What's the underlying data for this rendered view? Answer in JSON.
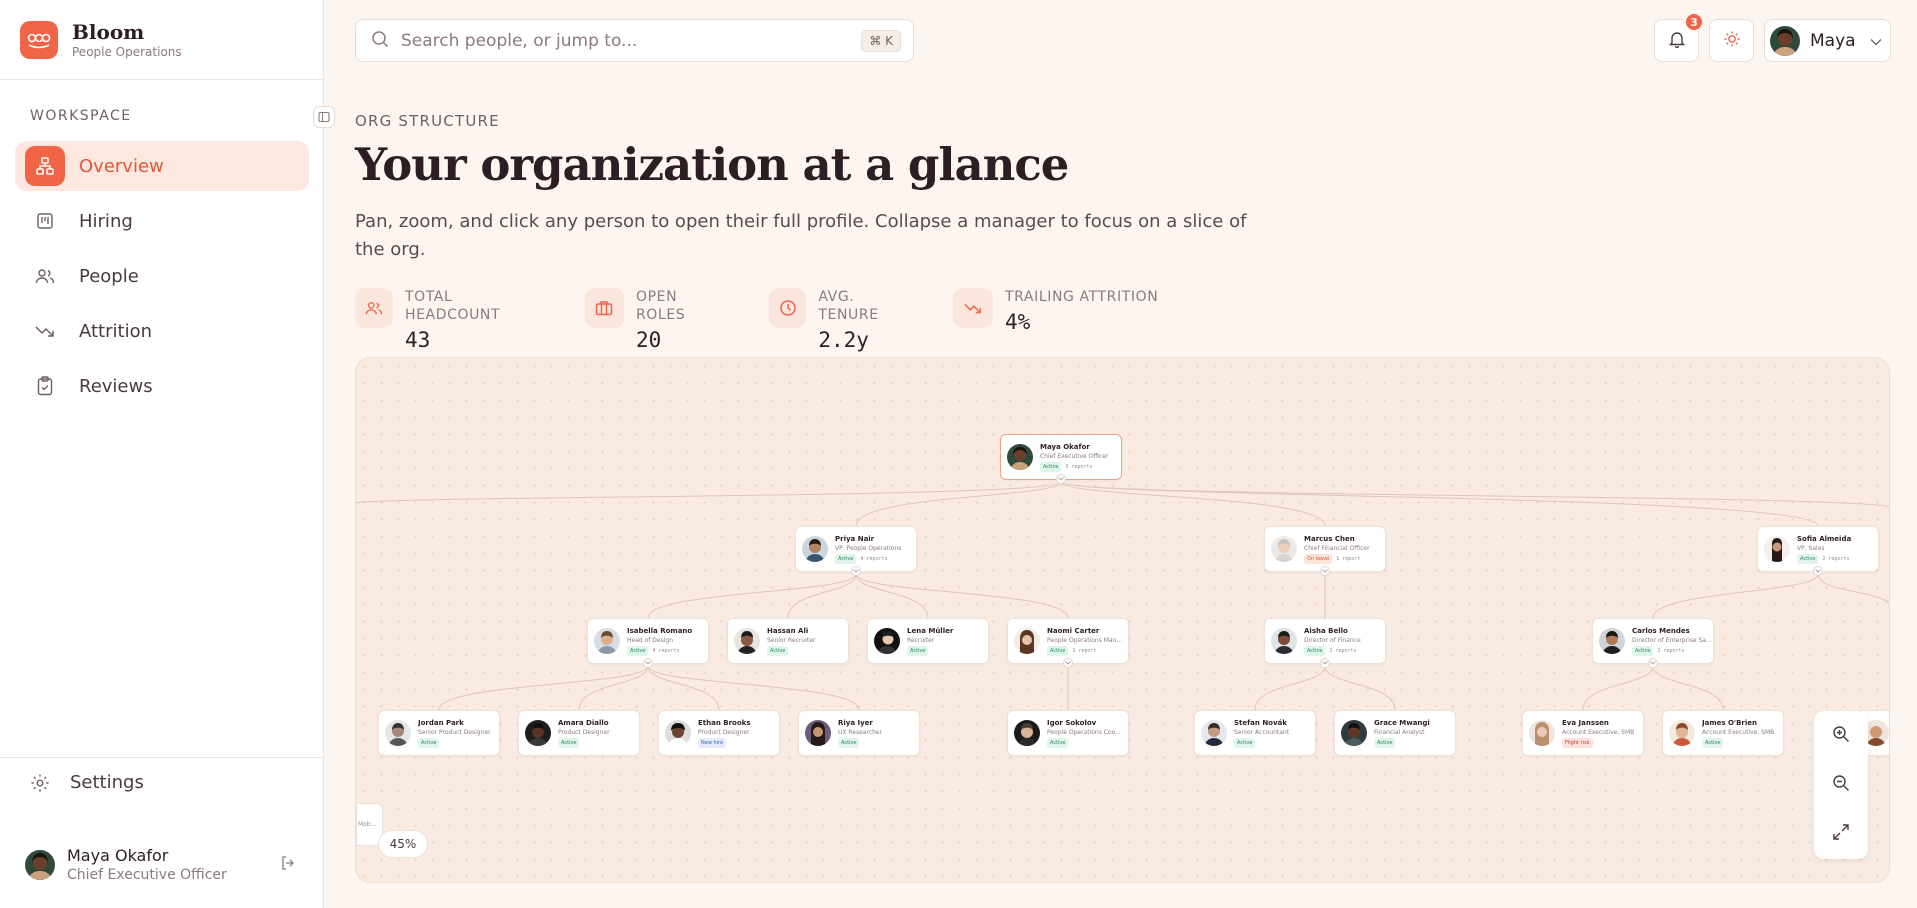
{
  "app": {
    "name": "Bloom",
    "subtitle": "People Operations"
  },
  "sidebar": {
    "section_label": "WORKSPACE",
    "items": [
      {
        "label": "Overview",
        "icon": "org-chart-icon",
        "active": true
      },
      {
        "label": "Hiring",
        "icon": "kanban-icon",
        "active": false
      },
      {
        "label": "People",
        "icon": "people-icon",
        "active": false
      },
      {
        "label": "Attrition",
        "icon": "trend-down-icon",
        "active": false
      },
      {
        "label": "Reviews",
        "icon": "clipboard-check-icon",
        "active": false
      }
    ],
    "settings_label": "Settings",
    "user": {
      "name": "Maya Okafor",
      "role": "Chief Executive Officer"
    }
  },
  "topbar": {
    "search_placeholder": "Search people, or jump to...",
    "shortcut": "⌘ K",
    "notification_count": "3",
    "user_name": "Maya"
  },
  "page": {
    "eyebrow": "ORG STRUCTURE",
    "title": "Your organization at a glance",
    "description": "Pan, zoom, and click any person to open their full profile. Collapse a manager to focus on a slice of the org."
  },
  "stats": [
    {
      "label": "TOTAL HEADCOUNT",
      "value": "43",
      "icon": "people-icon"
    },
    {
      "label": "OPEN ROLES",
      "value": "20",
      "icon": "briefcase-icon"
    },
    {
      "label": "AVG. TENURE",
      "value": "2.2y",
      "icon": "clock-icon"
    },
    {
      "label": "TRAILING ATTRITION",
      "value": "4%",
      "icon": "trend-down-icon"
    }
  ],
  "org": {
    "root": {
      "name": "Maya Okafor",
      "title": "Chief Executive Officer",
      "status": "Active",
      "reports": "5 reports"
    },
    "level1": [
      {
        "name": "Priya Nair",
        "title": "VP, People Operations",
        "status": "Active",
        "reports": "4 reports"
      },
      {
        "name": "Marcus Chen",
        "title": "Chief Financial Officer",
        "status": "On leave",
        "reports": "1 report"
      },
      {
        "name": "Sofia Almeida",
        "title": "VP, Sales",
        "status": "Active",
        "reports": "2 reports"
      }
    ],
    "level2": [
      {
        "name": "Isabella Romano",
        "title": "Head of Design",
        "status": "Active",
        "reports": "4 reports"
      },
      {
        "name": "Hassan Ali",
        "title": "Senior Recruiter",
        "status": "Active",
        "reports": ""
      },
      {
        "name": "Lena Müller",
        "title": "Recruiter",
        "status": "Active",
        "reports": ""
      },
      {
        "name": "Naomi Carter",
        "title": "People Operations Man...",
        "status": "Active",
        "reports": "1 report"
      },
      {
        "name": "Aisha Bello",
        "title": "Director of Finance",
        "status": "Active",
        "reports": "2 reports"
      },
      {
        "name": "Carlos Mendes",
        "title": "Director of Enterprise Sa...",
        "status": "Active",
        "reports": "2 reports"
      }
    ],
    "level3": [
      {
        "name": "Jordan Park",
        "title": "Senior Product Designer",
        "status": "Active"
      },
      {
        "name": "Amara Diallo",
        "title": "Product Designer",
        "status": "Active"
      },
      {
        "name": "Ethan Brooks",
        "title": "Product Designer",
        "status": "New hire"
      },
      {
        "name": "Riya Iyer",
        "title": "UX Researcher",
        "status": "Active"
      },
      {
        "name": "Igor Sokolov",
        "title": "People Operations Coo...",
        "status": "Active"
      },
      {
        "name": "Stefan Novák",
        "title": "Senior Accountant",
        "status": "Active"
      },
      {
        "name": "Grace Mwangi",
        "title": "Financial Analyst",
        "status": "Active"
      },
      {
        "name": "Eva Janssen",
        "title": "Account Executive, SMB",
        "status": "Flight risk"
      },
      {
        "name": "James O'Brien",
        "title": "Account Executive, SMB",
        "status": "Active"
      }
    ]
  },
  "canvas": {
    "zoom": "45%",
    "minimap_label": "Mob..."
  },
  "colors": {
    "accent": "#f06447",
    "accent_soft": "#fde7de",
    "bg": "#fdf5ef",
    "ink": "#2d1e24"
  }
}
